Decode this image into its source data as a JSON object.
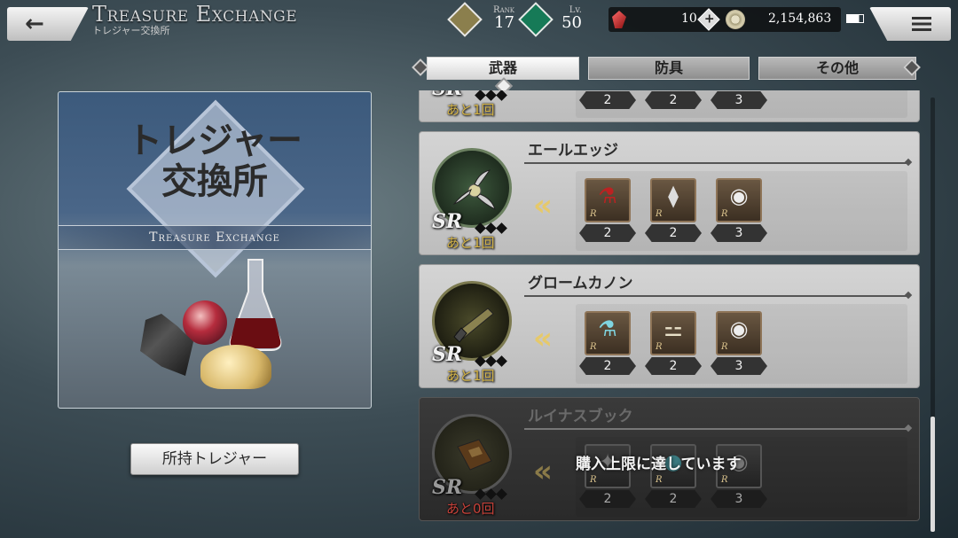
{
  "header": {
    "back_icon": "←",
    "title": "Treasure Exchange",
    "subtitle": "トレジャー交換所",
    "menu_icon": "menu-icon"
  },
  "status": {
    "rank_label": "Rank",
    "rank_value": "17",
    "lv_label": "Lv.",
    "lv_value": "50",
    "crystals": "10",
    "plus_glyph": "+",
    "gold": "2,154,863"
  },
  "banner": {
    "title_line1": "トレジャー",
    "title_line2": "交換所",
    "english": "Treasure Exchange"
  },
  "owned_button": "所持トレジャー",
  "tabs": [
    {
      "label": "武器",
      "active": true
    },
    {
      "label": "防具",
      "active": false
    },
    {
      "label": "その他",
      "active": false
    }
  ],
  "items": [
    {
      "name": "",
      "rarity": "SR",
      "remaining": "あと1回",
      "materials": [
        {
          "qty": "2"
        },
        {
          "qty": "2"
        },
        {
          "qty": "3"
        }
      ],
      "locked": false
    },
    {
      "name": "エールエッジ",
      "rarity": "SR",
      "remaining": "あと1回",
      "materials": [
        {
          "icon": "flask-icon",
          "glyph": "⚗",
          "r": "R",
          "qty": "2"
        },
        {
          "icon": "claw-icon",
          "glyph": "⧫",
          "r": "R",
          "qty": "2"
        },
        {
          "icon": "eye-icon",
          "glyph": "◉",
          "r": "R",
          "qty": "3"
        }
      ],
      "locked": false
    },
    {
      "name": "グロームカノン",
      "rarity": "SR",
      "remaining": "あと1回",
      "materials": [
        {
          "icon": "flask-icon",
          "glyph": "⚗",
          "r": "R",
          "qty": "2"
        },
        {
          "icon": "bone-icon",
          "glyph": "⚍",
          "r": "R",
          "qty": "2"
        },
        {
          "icon": "eye-icon",
          "glyph": "◉",
          "r": "R",
          "qty": "3"
        }
      ],
      "locked": false
    },
    {
      "name": "ルイナスブック",
      "rarity": "SR",
      "remaining": "あと0回",
      "materials": [
        {
          "icon": "material-icon",
          "glyph": "✦",
          "r": "R",
          "qty": "2"
        },
        {
          "icon": "material-icon",
          "glyph": "●",
          "r": "R",
          "qty": "2"
        },
        {
          "icon": "eye-icon",
          "glyph": "◉",
          "r": "R",
          "qty": "3"
        }
      ],
      "locked": true,
      "message": "購入上限に達しています"
    }
  ]
}
